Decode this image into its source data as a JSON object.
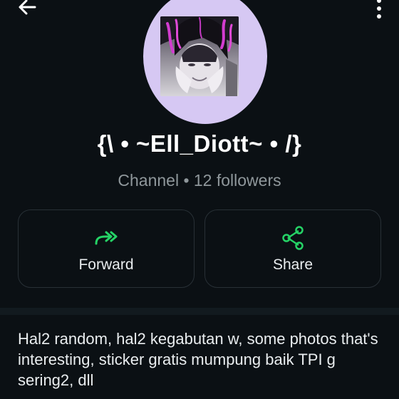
{
  "header": {
    "back_icon": "arrow-left-icon",
    "menu_icon": "more-vertical-icon"
  },
  "channel": {
    "name": "{\\ • ~Ell_Diott~ • /}",
    "subtitle": "Channel • 12 followers",
    "avatar_bg": "#d6c8f3"
  },
  "actions": {
    "forward": {
      "label": "Forward",
      "icon": "forward-icon"
    },
    "share": {
      "label": "Share",
      "icon": "share-icon"
    },
    "accent": "#25d366"
  },
  "description": {
    "text": "Hal2 random, hal2 kegabutan w, some photos that's interesting, sticker gratis mumpung baik TPI g sering2,  dll"
  }
}
